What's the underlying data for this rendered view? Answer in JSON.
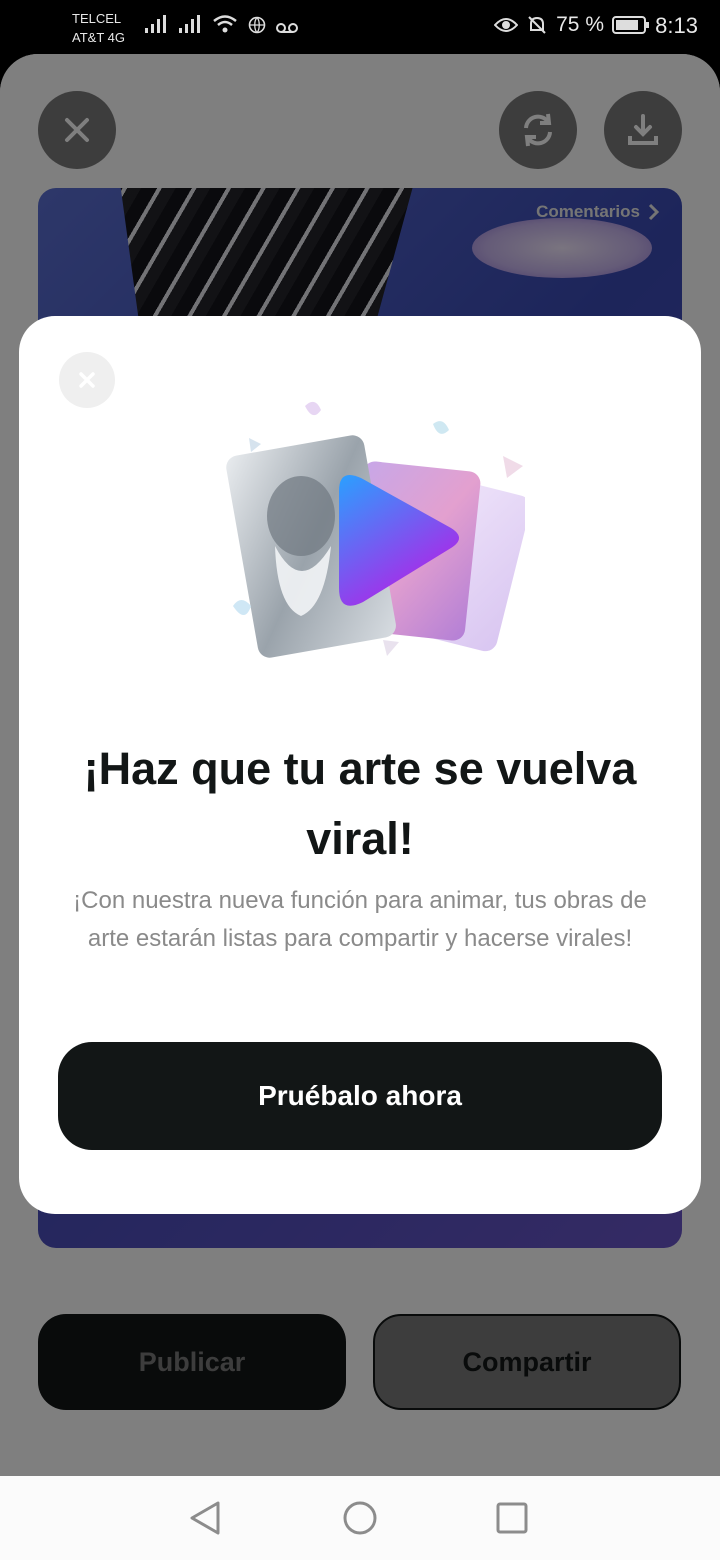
{
  "status_bar": {
    "carrier_line1": "TELCEL",
    "carrier_line2": "AT&T 4G",
    "battery_percent": "75 %",
    "time": "8:13"
  },
  "header": {
    "close_icon": "close-icon",
    "refresh_icon": "refresh-icon",
    "download_icon": "download-icon"
  },
  "preview": {
    "comments_label": "Comentarios"
  },
  "modal": {
    "title": "¡Haz que tu arte se vuelva viral!",
    "description": "¡Con nuestra nueva función para animar, tus obras de arte estarán listas para compartir y hacerse virales!",
    "cta_label": "Pruébalo ahora"
  },
  "actions": {
    "publish_label": "Publicar",
    "share_label": "Compartir"
  },
  "colors": {
    "primary_dark": "#121616",
    "play_gradient_start": "#2aa0ff",
    "play_gradient_end": "#b321e6"
  }
}
